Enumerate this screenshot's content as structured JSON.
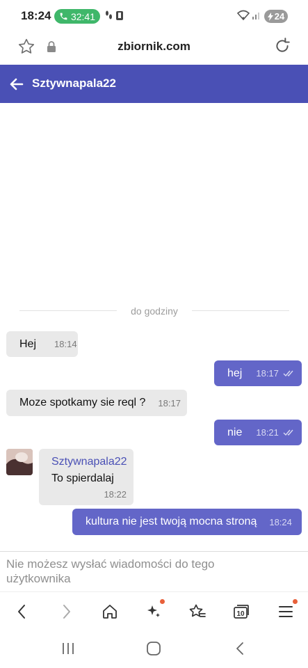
{
  "status_bar": {
    "time": "18:24",
    "call_timer": "32:41",
    "battery": "24"
  },
  "browser": {
    "url": "zbiornik.com",
    "tab_count": "10"
  },
  "chat": {
    "title": "Sztywnapala22",
    "divider": "do godziny",
    "messages": [
      {
        "direction": "incoming",
        "text": "Hej",
        "time": "18:14"
      },
      {
        "direction": "outgoing",
        "text": "hej",
        "time": "18:17",
        "read": true
      },
      {
        "direction": "incoming",
        "text": "Moze spotkamy sie reql ?",
        "time": "18:17"
      },
      {
        "direction": "outgoing",
        "text": "nie",
        "time": "18:21",
        "read": true
      },
      {
        "direction": "incoming",
        "sender": "Sztywnapala22",
        "text": "To spierdalaj",
        "time": "18:22"
      },
      {
        "direction": "outgoing",
        "text": "kultura nie jest twoją mocna stroną",
        "time": "18:24",
        "read": false
      }
    ],
    "notice": "Nie możesz wysłać wiadomości do tego użytkownika"
  },
  "colors": {
    "header": "#4a50b5",
    "outgoing_bubble": "#6366c8",
    "incoming_bubble": "#e9e9e9",
    "call_pill": "#3fb76a",
    "notification_dot": "#e8603a"
  },
  "icons": [
    "phone-icon",
    "wifi-icon",
    "signal-icon",
    "battery-icon",
    "star-icon",
    "lock-icon",
    "reload-icon",
    "back-arrow-icon",
    "double-check-icon",
    "back-icon",
    "forward-icon",
    "home-icon",
    "sparkle-icon",
    "bookmarks-icon",
    "tabs-icon",
    "menu-icon",
    "recents-icon",
    "home-button-icon",
    "system-back-icon"
  ]
}
